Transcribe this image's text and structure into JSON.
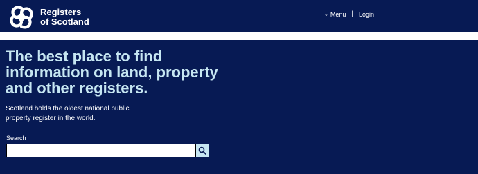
{
  "header": {
    "brand_line1": "Registers",
    "brand_line2": "of Scotland",
    "nav": {
      "menu_label": "Menu",
      "login_label": "Login"
    }
  },
  "hero": {
    "title": "The best place to find information on land, property and other registers.",
    "subtitle": "Scotland holds the oldest national public property register in the world."
  },
  "search": {
    "label": "Search",
    "value": "",
    "placeholder": ""
  },
  "icons": {
    "logo": "celtic-knot-logo-icon",
    "menu": "chevron-down-icon",
    "search": "search-icon"
  },
  "colors": {
    "navy": "#071a54",
    "light_blue": "#c6e6f2",
    "white": "#ffffff"
  }
}
